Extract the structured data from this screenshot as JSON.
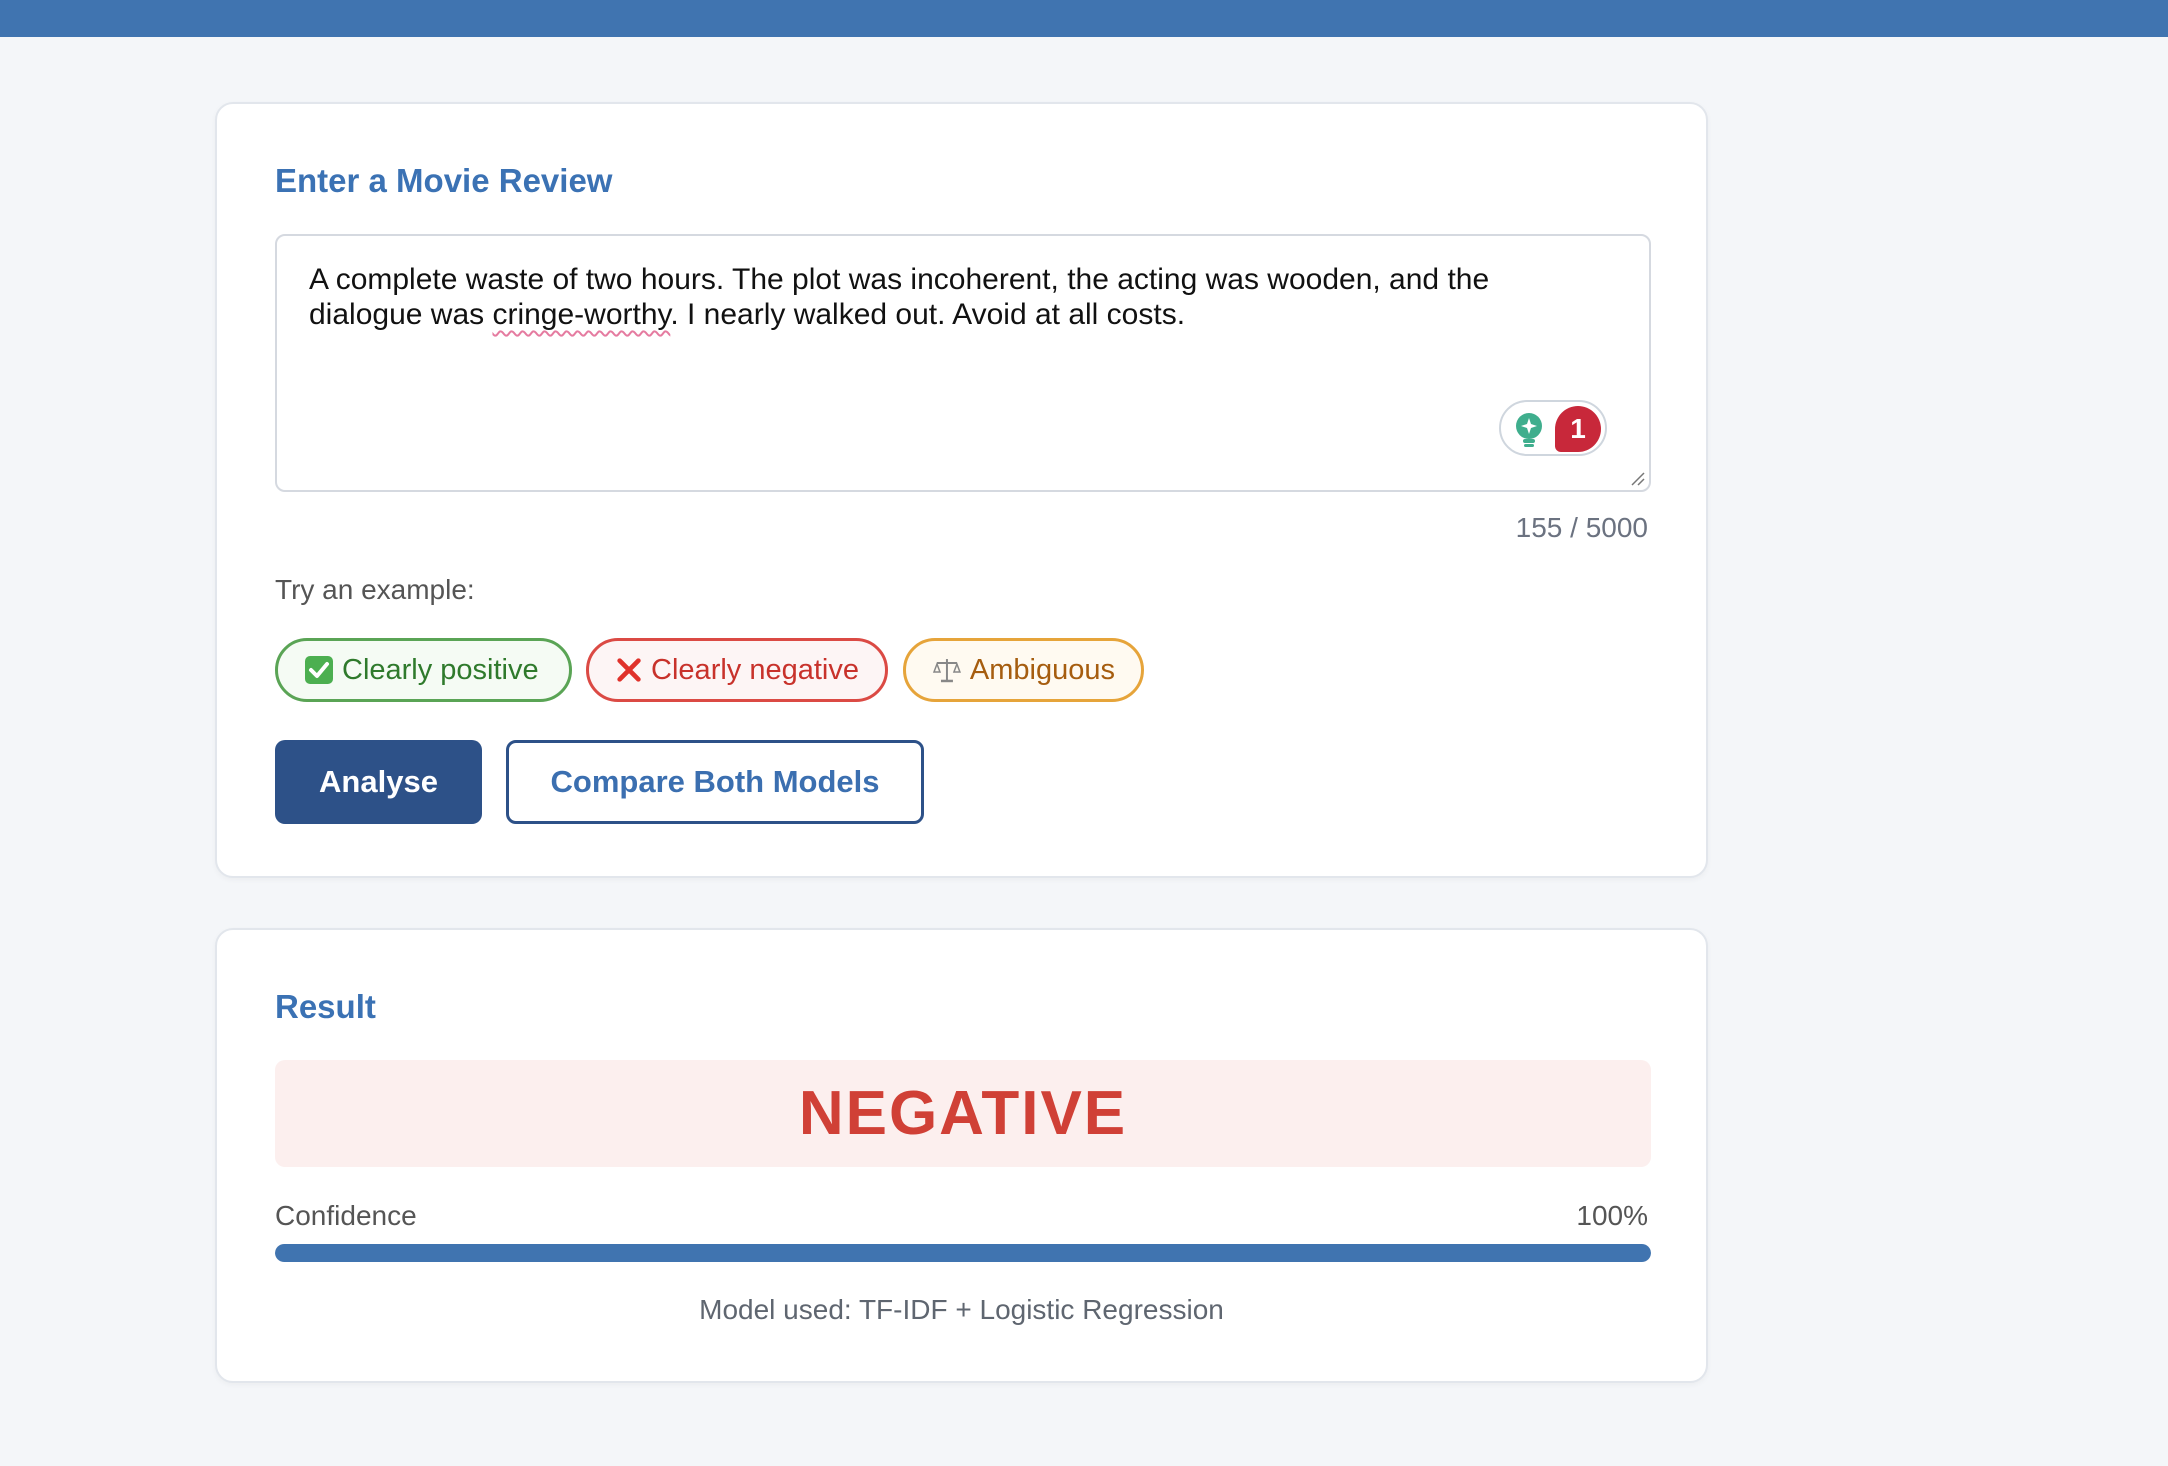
{
  "input_card": {
    "title": "Enter a Movie Review",
    "review": {
      "text_before": "A complete waste of two hours. The plot was incoherent, the acting was wooden, and the\ndialogue was ",
      "misspelled": "cringe-worthy",
      "text_after": ". I nearly walked out. Avoid at all costs."
    },
    "grammar_badge_count": "1",
    "char_count": "155 / 5000",
    "examples_label": "Try an example:",
    "examples": [
      {
        "label": "Clearly positive",
        "icon": "check-mark-icon",
        "color": "#5aa455"
      },
      {
        "label": "Clearly negative",
        "icon": "cross-mark-icon",
        "color": "#db4a44"
      },
      {
        "label": "Ambiguous",
        "icon": "balance-scale-icon",
        "color": "#e6a43a"
      }
    ],
    "analyse_label": "Analyse",
    "compare_label": "Compare Both Models"
  },
  "result_card": {
    "title": "Result",
    "sentiment": "NEGATIVE",
    "sentiment_color": "#d04036",
    "confidence_label": "Confidence",
    "confidence_value": "100%",
    "confidence_fraction": 1.0,
    "model_used": "Model used: TF-IDF + Logistic Regression"
  },
  "colors": {
    "brand": "#4074b0",
    "primary_button": "#2d5188"
  }
}
